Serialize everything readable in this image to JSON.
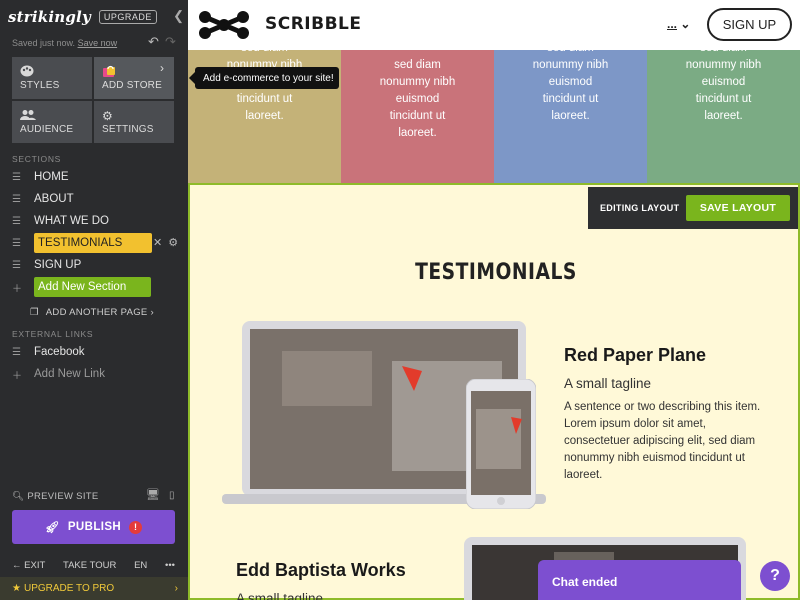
{
  "sidebar": {
    "logo": "strikingly",
    "upgrade_badge": "UPGRADE",
    "saved_text": "Saved just now.",
    "save_now": "Save now",
    "tiles": [
      {
        "label": "STYLES",
        "icon": "palette-icon"
      },
      {
        "label": "ADD STORE",
        "icon": "store-bag-icon"
      },
      {
        "label": "AUDIENCE",
        "icon": "people-icon"
      },
      {
        "label": "SETTINGS",
        "icon": "gear-icon"
      }
    ],
    "tooltip": "Add e-commerce to your site!",
    "sections_heading": "SECTIONS",
    "sections": [
      "HOME",
      "ABOUT",
      "WHAT WE DO",
      "TESTIMONIALS",
      "SIGN UP"
    ],
    "add_section": "Add New Section",
    "add_page": "ADD ANOTHER PAGE",
    "external_heading": "EXTERNAL LINKS",
    "external_links": [
      "Facebook"
    ],
    "add_link": "Add New Link",
    "preview": "PREVIEW SITE",
    "publish": "PUBLISH",
    "bottom": {
      "exit": "EXIT",
      "tour": "TAKE TOUR",
      "lang": "EN",
      "more": "•••"
    },
    "upgrade_pro": "UPGRADE TO PRO"
  },
  "site": {
    "brand": "SCRIBBLE",
    "nav_more": "...",
    "signup_button": "SIGN UP",
    "columns": [
      {
        "color": "#c4b278",
        "lines": [
          "sed diam",
          "nonummy nibh",
          "euismod",
          "tincidunt ut",
          "laoreet."
        ]
      },
      {
        "color": "#c9737a",
        "lines": [
          "",
          "sed diam",
          "nonummy nibh",
          "euismod",
          "tincidunt ut",
          "laoreet."
        ]
      },
      {
        "color": "#7d97c7",
        "lines": [
          "sed diam",
          "nonummy nibh",
          "euismod",
          "tincidunt ut",
          "laoreet."
        ]
      },
      {
        "color": "#7bab84",
        "lines": [
          "sed diam",
          "nonummy nibh",
          "euismod",
          "tincidunt ut",
          "laoreet."
        ]
      }
    ],
    "editing_layout": "EDITING LAYOUT",
    "save_layout": "SAVE LAYOUT",
    "section_title": "TESTIMONIALS",
    "testimonials": [
      {
        "title": "Red Paper Plane",
        "tagline": "A small tagline",
        "body": "A sentence or two describing this item. Lorem ipsum dolor sit amet, consectetuer adipiscing elit, sed diam nonummy nibh euismod tincidunt ut laoreet."
      },
      {
        "title": "Edd Baptista Works",
        "tagline": "A small tagline"
      }
    ],
    "chat": "Chat ended",
    "chat_help": "?"
  }
}
